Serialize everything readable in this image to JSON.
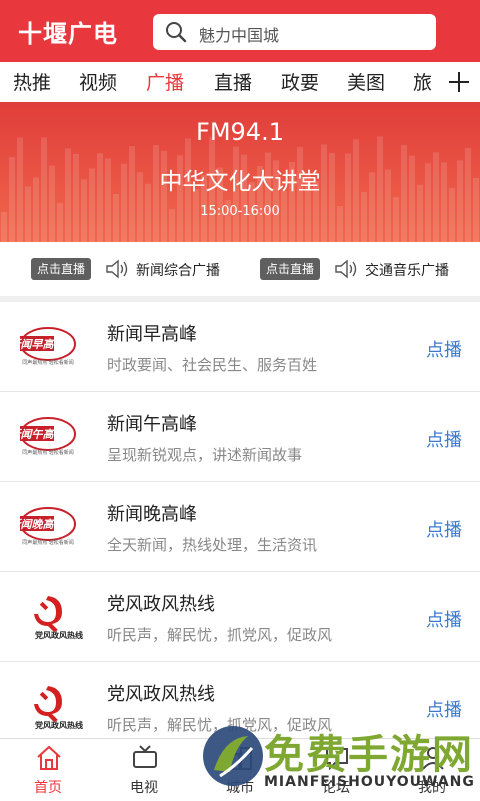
{
  "header": {
    "title": "十堰广电",
    "search_placeholder": "魅力中国城"
  },
  "tabs": [
    "热推",
    "视频",
    "广播",
    "直播",
    "政要",
    "美图",
    "旅"
  ],
  "active_tab": "广播",
  "banner": {
    "frequency": "FM94.1",
    "program": "中华文化大讲堂",
    "time": "15:00-16:00"
  },
  "live": [
    {
      "button": "点击直播",
      "label": "新闻综合广播"
    },
    {
      "button": "点击直播",
      "label": "交通音乐广播"
    }
  ],
  "programs": [
    {
      "title": "新闻早高峰",
      "desc": "时政要闻、社会民生、服务百姓",
      "play": "点播",
      "logo_text": "新闻早高峰",
      "logo_sub": "同声最热点 轻松看新闻"
    },
    {
      "title": "新闻午高峰",
      "desc": "呈现新锐观点，讲述新闻故事",
      "play": "点播",
      "logo_text": "新闻午高峰",
      "logo_sub": "同声最热点 轻松看新闻"
    },
    {
      "title": "新闻晚高峰",
      "desc": "全天新闻，热线处理，生活资讯",
      "play": "点播",
      "logo_text": "新闻晚高峰",
      "logo_sub": "同声最热点 轻松看新闻"
    },
    {
      "title": "党风政风热线",
      "desc": "听民声，解民忧，抓党风，促政风",
      "play": "点播",
      "logo_text": "党风政风热线"
    },
    {
      "title": "党风政风热线",
      "desc": "听民声，解民忧，抓党风，促政风",
      "play": "点播",
      "logo_text": "党风政风热线"
    }
  ],
  "nav": [
    {
      "label": "首页",
      "icon": "home-icon"
    },
    {
      "label": "电视",
      "icon": "tv-icon"
    },
    {
      "label": "城市",
      "icon": "city-icon"
    },
    {
      "label": "论坛",
      "icon": "forum-icon"
    },
    {
      "label": "我的",
      "icon": "user-icon"
    }
  ],
  "watermark": {
    "zh": "免费手游网",
    "en": "MIANFEISHOUYOUWANG"
  },
  "colors": {
    "brand": "#e8383d",
    "play": "#3b7bd0",
    "watermark": "#7fa832"
  }
}
